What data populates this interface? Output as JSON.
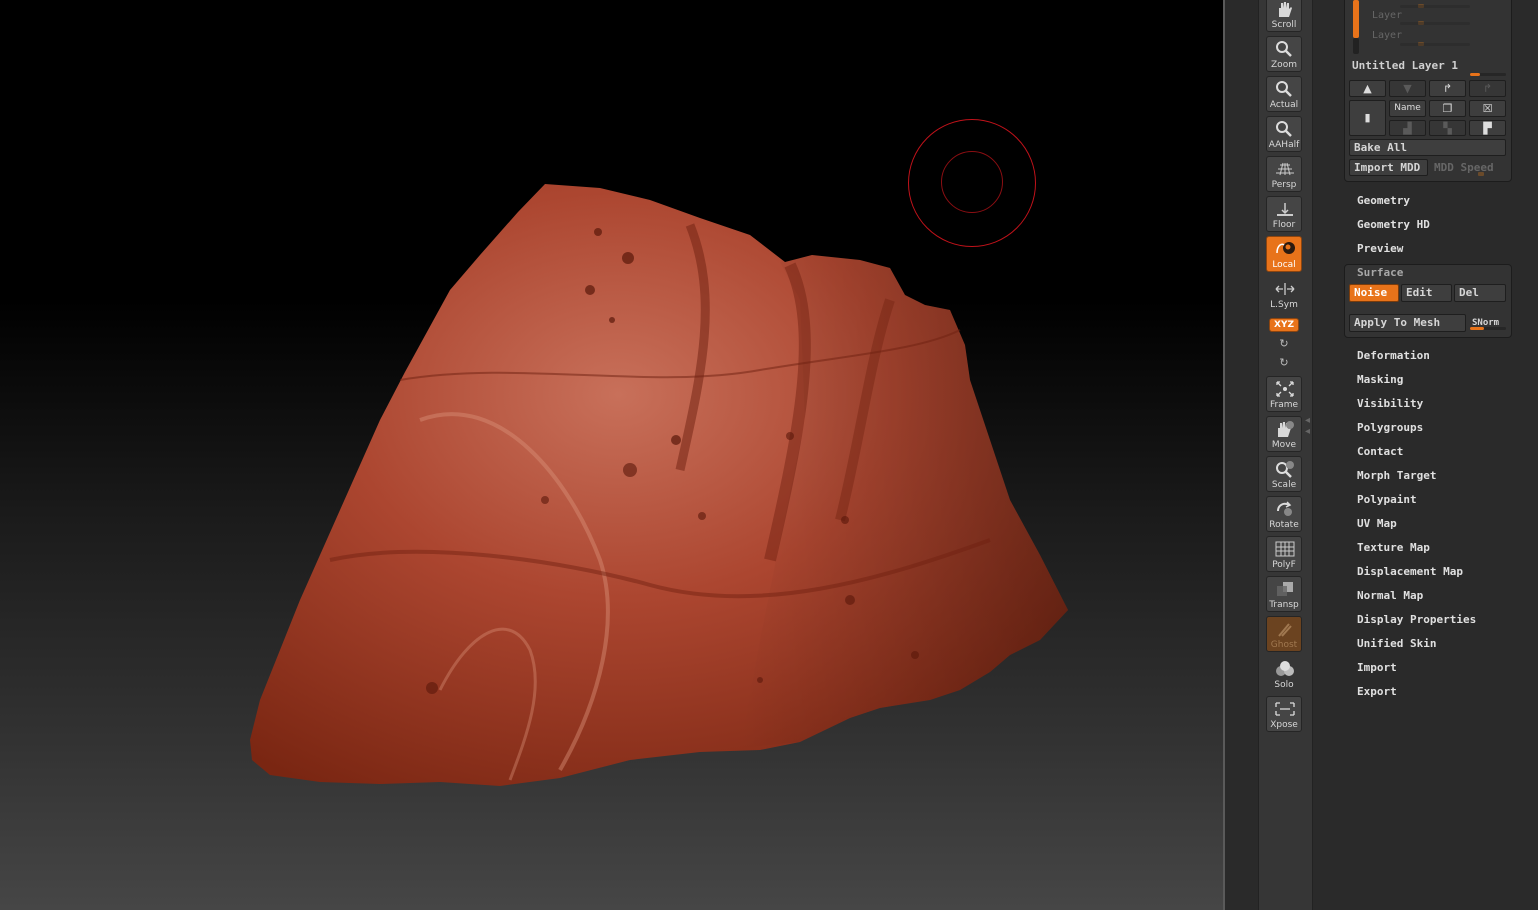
{
  "colors": {
    "accent": "#e8731a",
    "mesh": "#a83a22",
    "cursor": "#c0121a",
    "panel": "#2a2a2a"
  },
  "shelf": [
    {
      "id": "scroll",
      "label": "Scroll",
      "icon": "hand-icon"
    },
    {
      "id": "zoom",
      "label": "Zoom",
      "icon": "magnifier-icon"
    },
    {
      "id": "actual",
      "label": "Actual",
      "icon": "magnifier-icon"
    },
    {
      "id": "aahalf",
      "label": "AAHalf",
      "icon": "magnifier-icon"
    },
    {
      "id": "persp",
      "label": "Persp",
      "icon": "perspective-grid-icon"
    },
    {
      "id": "floor",
      "label": "Floor",
      "icon": "floor-icon"
    },
    {
      "id": "local",
      "label": "Local",
      "icon": "local-pivot-icon",
      "active": true
    },
    {
      "id": "lsym",
      "label": "L.Sym",
      "icon": "symmetry-arrows-icon"
    },
    {
      "id": "xyz",
      "label": "XYZ",
      "active": true
    },
    {
      "id": "frame",
      "label": "Frame",
      "icon": "frame-icon"
    },
    {
      "id": "move",
      "label": "Move",
      "icon": "hand-icon"
    },
    {
      "id": "scale",
      "label": "Scale",
      "icon": "scale-icon"
    },
    {
      "id": "rotate",
      "label": "Rotate",
      "icon": "rotate-icon"
    },
    {
      "id": "polyf",
      "label": "PolyF",
      "icon": "polyframe-grid-icon"
    },
    {
      "id": "transp",
      "label": "Transp",
      "icon": "transparency-icon"
    },
    {
      "id": "ghost",
      "label": "Ghost",
      "icon": "ghost-icon",
      "disabled": true
    },
    {
      "id": "solo",
      "label": "Solo",
      "icon": "solo-spheres-icon"
    },
    {
      "id": "xpose",
      "label": "Xpose",
      "icon": "xpose-arrows-icon"
    }
  ],
  "layers": {
    "rows": [
      "Layer",
      "Layer"
    ],
    "current": "Untitled Layer 1",
    "name_button": "Name",
    "bake_all": "Bake All",
    "import_mdd": "Import MDD",
    "mdd_speed": "MDD Speed"
  },
  "menu_top": [
    "Geometry",
    "Geometry HD",
    "Preview"
  ],
  "surface": {
    "title": "Surface",
    "noise": "Noise",
    "edit": "Edit",
    "del": "Del",
    "apply": "Apply To Mesh",
    "snorm": "SNorm"
  },
  "menu_bottom": [
    "Deformation",
    "Masking",
    "Visibility",
    "Polygroups",
    "Contact",
    "Morph Target",
    "Polypaint",
    "UV Map",
    "Texture Map",
    "Displacement Map",
    "Normal Map",
    "Display Properties",
    "Unified Skin",
    "Import",
    "Export"
  ]
}
